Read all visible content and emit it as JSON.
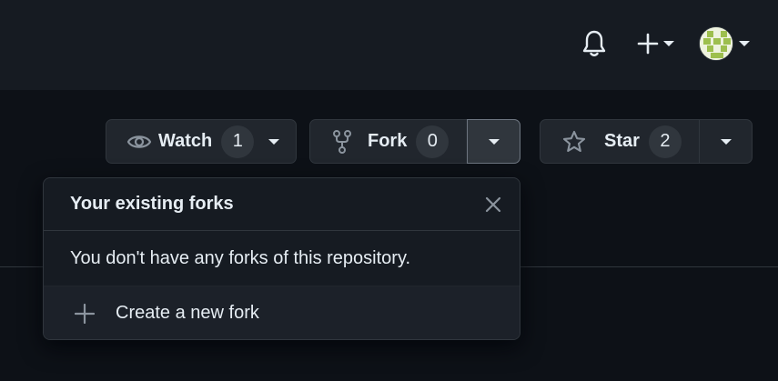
{
  "watch": {
    "label": "Watch",
    "count": "1"
  },
  "fork": {
    "label": "Fork",
    "count": "0"
  },
  "star": {
    "label": "Star",
    "count": "2"
  },
  "forks_popover": {
    "title": "Your existing forks",
    "message": "You don't have any forks of this repository.",
    "create_label": "Create a new fork"
  },
  "icons": {
    "notifications": "bell-icon",
    "create": "plus-icon",
    "watch": "eye-icon",
    "fork": "repo-forked-icon",
    "star": "star-icon",
    "close": "x-icon"
  },
  "colors": {
    "topbar_bg": "#161b22",
    "page_bg": "#0d1117",
    "button_bg": "#21262d",
    "border": "#30363d",
    "text": "#e6edf3"
  }
}
